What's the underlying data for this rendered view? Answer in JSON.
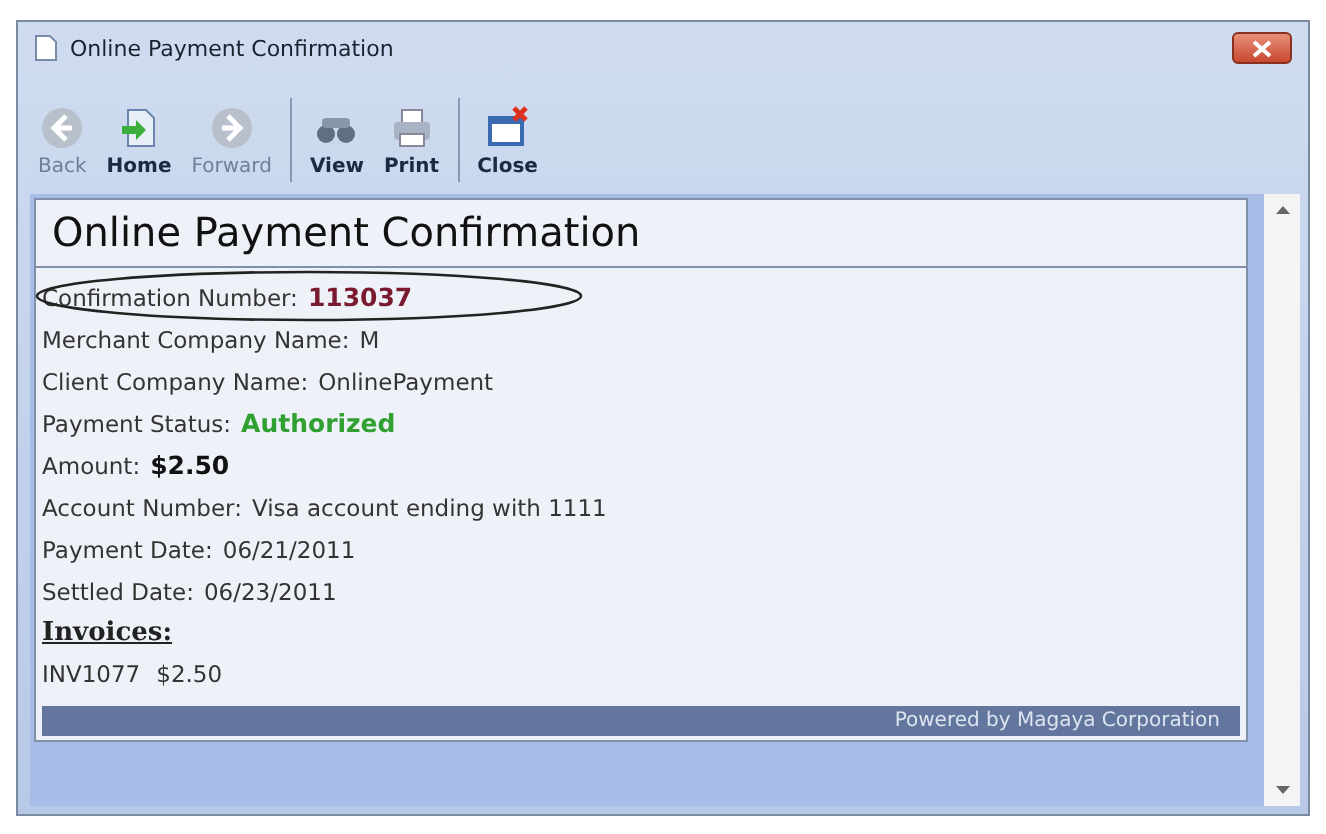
{
  "window": {
    "title": "Online Payment Confirmation"
  },
  "toolbar": [
    {
      "label": "Back",
      "kind": "back",
      "disabled": true
    },
    {
      "label": "Home",
      "kind": "home",
      "disabled": false
    },
    {
      "label": "Forward",
      "kind": "forward",
      "disabled": true
    },
    {
      "label": "View",
      "kind": "view",
      "disabled": false
    },
    {
      "label": "Print",
      "kind": "print",
      "disabled": false
    },
    {
      "label": "Close",
      "kind": "close",
      "disabled": false
    }
  ],
  "page": {
    "heading": "Online Payment Confirmation",
    "fields": [
      {
        "label": "Confirmation Number:",
        "value": "113037",
        "kind": "code",
        "circled": true
      },
      {
        "label": "Merchant Company Name:",
        "value": "M",
        "kind": "plain",
        "circled": false
      },
      {
        "label": "Client Company Name:",
        "value": "OnlinePayment",
        "kind": "plain",
        "circled": false
      },
      {
        "label": "Payment Status:",
        "value": "Authorized",
        "kind": "status",
        "circled": false
      },
      {
        "label": "Amount:",
        "value": "$2.50",
        "kind": "bold",
        "circled": false
      },
      {
        "label": "Account Number:",
        "value": "Visa account ending with 1111",
        "kind": "plain",
        "circled": false
      },
      {
        "label": "Payment Date:",
        "value": "06/21/2011",
        "kind": "plain",
        "circled": false
      },
      {
        "label": "Settled Date:",
        "value": "06/23/2011",
        "kind": "plain",
        "circled": false
      }
    ],
    "invoices_heading": "Invoices:",
    "invoices": [
      {
        "number": "INV1077",
        "amount": "$2.50"
      }
    ],
    "footer": "Powered by Magaya Corporation"
  }
}
